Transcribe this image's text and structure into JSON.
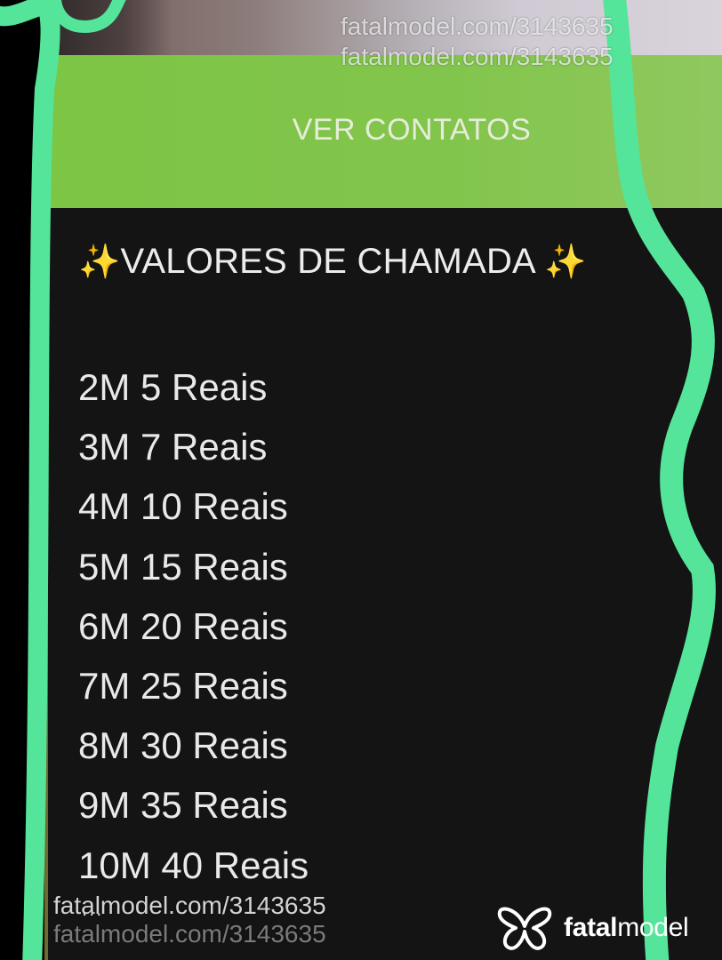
{
  "watermark": {
    "text_1": "fatalmodel.com/3143635",
    "text_2": "fatalmodel.com/3143635",
    "text_3": "fatalmodel.com/3143635",
    "text_4": "fatalmodel.com/3143635"
  },
  "contact_button": {
    "label": "VER CONTATOS"
  },
  "call_prices": {
    "title_left_icon": "✨",
    "title": "VALORES DE CHAMADA",
    "title_right_icon": "✨",
    "items": [
      "2M 5 Reais",
      "3M 7 Reais",
      "4M 10 Reais",
      "5M 15 Reais",
      "6M 20 Reais",
      "7M 25 Reais",
      "8M 30 Reais",
      "9M 35 Reais",
      "10M 40 Reais"
    ],
    "more": "..."
  },
  "brand": {
    "name_bold": "fatal",
    "name_light": "model",
    "logo_icon": "butterfly-icon"
  },
  "colors": {
    "accent_green": "#82c54c",
    "scribble_green": "#55e59a",
    "panel_dark": "#141414",
    "sparkle_gold": "#f2d250"
  }
}
